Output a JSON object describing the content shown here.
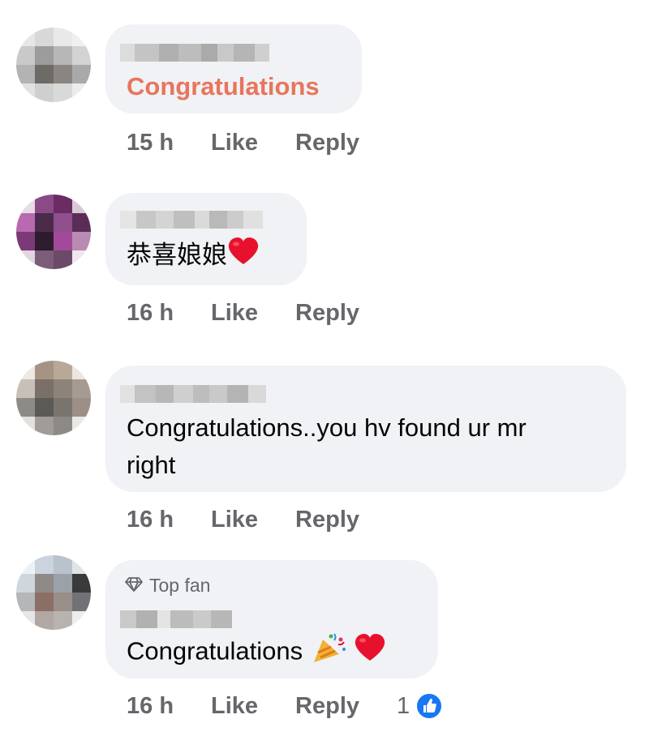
{
  "colors": {
    "bubble": "#f0f2f5",
    "meta_text": "#65676b",
    "highlight_text": "#e8755c",
    "like_blue": "#1877f2",
    "heart_red": "#e8112d"
  },
  "comments": [
    {
      "text": "Congratulations",
      "time": "15 h",
      "like": "Like",
      "reply": "Reply",
      "style": "highlight"
    },
    {
      "text": "恭喜娘娘",
      "emoji": [
        "red-heart-icon"
      ],
      "time": "16 h",
      "like": "Like",
      "reply": "Reply"
    },
    {
      "text_line1": "Congratulations..you hv found ur mr",
      "text_line2": "right",
      "time": "16 h",
      "like": "Like",
      "reply": "Reply"
    },
    {
      "badge": "Top fan",
      "badge_icon": "diamond-icon",
      "text": "Congratulations",
      "emoji": [
        "party-popper-icon",
        "red-heart-icon"
      ],
      "time": "16 h",
      "like": "Like",
      "reply": "Reply",
      "reaction_count": "1",
      "reaction_icon": "thumbs-up-icon"
    }
  ]
}
